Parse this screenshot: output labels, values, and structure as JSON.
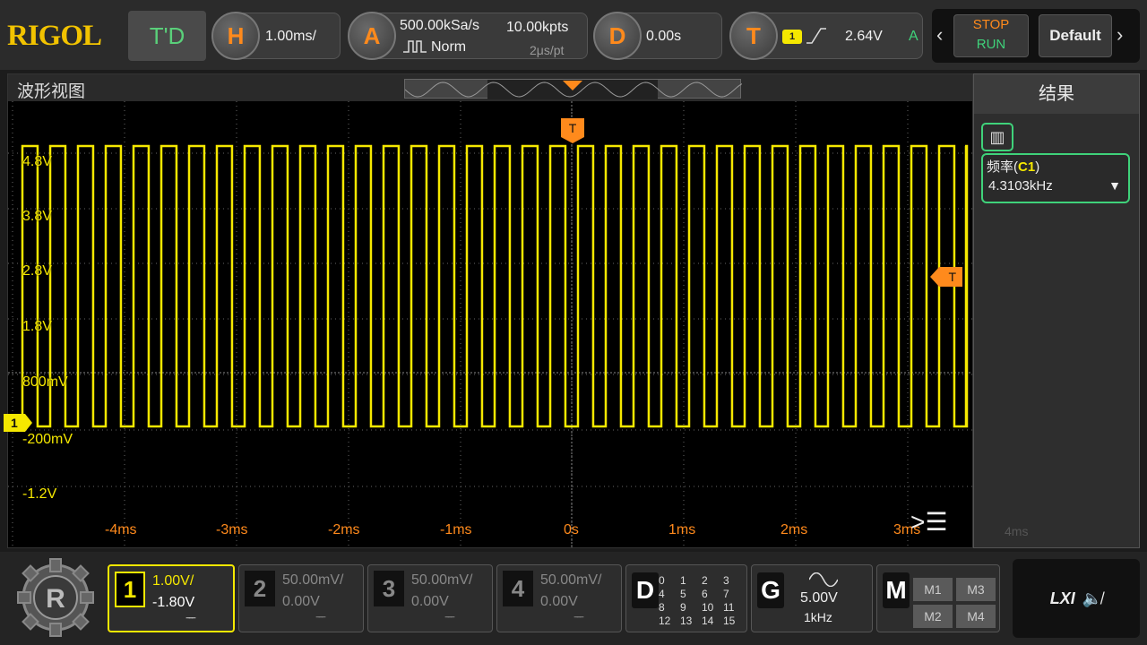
{
  "colors": {
    "ch1": "#f5e800",
    "orange": "#ff8a1c",
    "green": "#3fd27a",
    "bg": "#000000"
  },
  "topbar": {
    "logo": "RIGOL",
    "td_label": "T'D",
    "horizontal": {
      "letter": "H",
      "value": "1.00ms/"
    },
    "acquire": {
      "letter": "A",
      "sample_rate": "500.00kSa/s",
      "points": "10.00kpts",
      "mode_icon": "square-pulse-icon",
      "mode": "Norm",
      "time_per_pt": "2μs/pt"
    },
    "delay": {
      "letter": "D",
      "value": "0.00s"
    },
    "trigger": {
      "letter": "T",
      "source": "1",
      "slope_icon": "rising-edge-icon",
      "level": "2.64V",
      "mode": "A"
    },
    "stop_label": "STOP",
    "run_label": "RUN",
    "default_label": "Default",
    "prev_icon": "chevron-left-icon",
    "next_icon": "chevron-right-icon"
  },
  "wave": {
    "title": "波形视图",
    "trigger_marker": "T",
    "trigger_level_marker": "T",
    "channel_marker": "1",
    "y_labels": [
      "4.8V",
      "3.8V",
      "2.8V",
      "1.8V",
      "800mV",
      "-200mV",
      "-1.2V"
    ],
    "x_labels": [
      "-4ms",
      "-3ms",
      "-2ms",
      "-1ms",
      "0s",
      "1ms",
      "2ms",
      "3ms"
    ],
    "menu_icon": "menu-expand-icon"
  },
  "results": {
    "title": "结果",
    "item_label_prefix": "频率(",
    "item_source": "C1",
    "item_label_suffix": ")",
    "item_value": "4.3103kHz",
    "ghost_label": "4ms"
  },
  "bottombar": {
    "channels": [
      {
        "num": "1",
        "scale": "1.00V/",
        "offset": "-1.80V"
      },
      {
        "num": "2",
        "scale": "50.00mV/",
        "offset": "0.00V"
      },
      {
        "num": "3",
        "scale": "50.00mV/",
        "offset": "0.00V"
      },
      {
        "num": "4",
        "scale": "50.00mV/",
        "offset": "0.00V"
      }
    ],
    "digital": {
      "letter": "D",
      "channels": [
        "0",
        "1",
        "2",
        "3",
        "4",
        "5",
        "6",
        "7",
        "8",
        "9",
        "10",
        "11",
        "12",
        "13",
        "14",
        "15"
      ]
    },
    "generator": {
      "letter": "G",
      "amplitude": "5.00V",
      "frequency": "1kHz"
    },
    "math": {
      "letter": "M",
      "items": [
        "M1",
        "M3",
        "M2",
        "M4"
      ]
    },
    "lxi_label": "LXI",
    "speaker_icon": "speaker-muted-icon"
  }
}
